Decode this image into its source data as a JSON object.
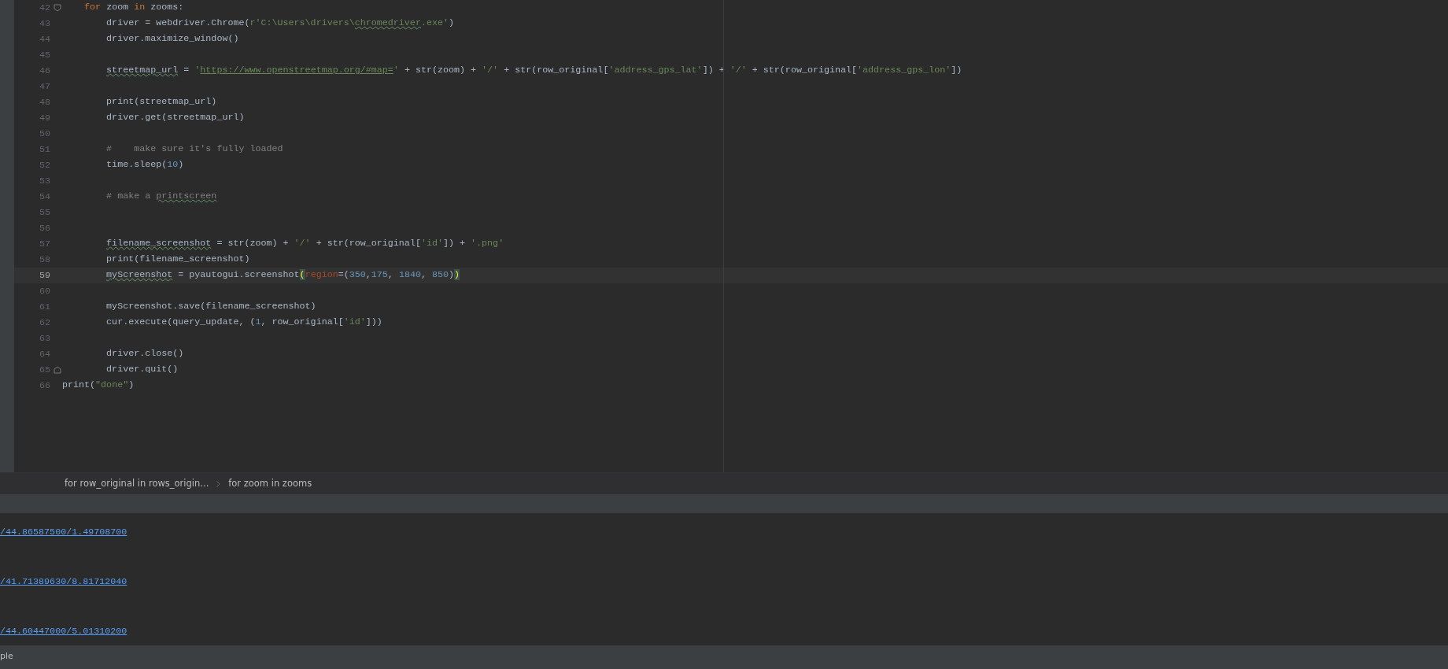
{
  "editor": {
    "lines": [
      {
        "number": "42",
        "current": false,
        "fold_start": true,
        "tokens": [
          {
            "text": "    for",
            "kind": "keyword"
          },
          {
            "text": " zoom ",
            "kind": "plain"
          },
          {
            "text": "in",
            "kind": "keyword"
          },
          {
            "text": " zooms:",
            "kind": "plain"
          }
        ]
      },
      {
        "number": "43",
        "current": false,
        "tokens": [
          {
            "text": "        driver = webdriver.Chrome(",
            "kind": "plain"
          },
          {
            "text": "r'C:\\Users\\drivers\\",
            "kind": "string"
          },
          {
            "text": "chromedriver",
            "kind": "string",
            "typo": true
          },
          {
            "text": ".exe'",
            "kind": "string"
          },
          {
            "text": ")",
            "kind": "plain"
          }
        ]
      },
      {
        "number": "44",
        "current": false,
        "tokens": [
          {
            "text": "        driver.maximize_window()",
            "kind": "plain"
          }
        ]
      },
      {
        "number": "45",
        "current": false
      },
      {
        "number": "46",
        "current": false,
        "tokens": [
          {
            "text": "        streetmap_url",
            "kind": "plain",
            "typo": true
          },
          {
            "text": " = ",
            "kind": "plain"
          },
          {
            "text": "'",
            "kind": "string"
          },
          {
            "text": "https://www.openstreetmap.org/#map=",
            "kind": "link"
          },
          {
            "text": "'",
            "kind": "string"
          },
          {
            "text": " + str(zoom) + ",
            "kind": "plain"
          },
          {
            "text": "'/'",
            "kind": "string"
          },
          {
            "text": " + str(row_original[",
            "kind": "plain"
          },
          {
            "text": "'address_gps_lat'",
            "kind": "string"
          },
          {
            "text": "]) + ",
            "kind": "plain"
          },
          {
            "text": "'/'",
            "kind": "string"
          },
          {
            "text": " + str(row_original[",
            "kind": "plain"
          },
          {
            "text": "'address_gps_lon'",
            "kind": "string"
          },
          {
            "text": "])",
            "kind": "plain"
          }
        ]
      },
      {
        "number": "47",
        "current": false
      },
      {
        "number": "48",
        "current": false,
        "tokens": [
          {
            "text": "        print(streetmap_url)",
            "kind": "plain"
          }
        ]
      },
      {
        "number": "49",
        "current": false,
        "tokens": [
          {
            "text": "        driver.get(streetmap_url)",
            "kind": "plain"
          }
        ]
      },
      {
        "number": "50",
        "current": false
      },
      {
        "number": "51",
        "current": false,
        "tokens": [
          {
            "text": "        #    make sure it's fully loaded",
            "kind": "comment"
          }
        ]
      },
      {
        "number": "52",
        "current": false,
        "tokens": [
          {
            "text": "        time.sleep(",
            "kind": "plain"
          },
          {
            "text": "10",
            "kind": "number"
          },
          {
            "text": ")",
            "kind": "plain"
          }
        ]
      },
      {
        "number": "53",
        "current": false
      },
      {
        "number": "54",
        "current": false,
        "tokens": [
          {
            "text": "        # make a ",
            "kind": "comment"
          },
          {
            "text": "printscreen",
            "kind": "comment",
            "typo": true
          }
        ]
      },
      {
        "number": "55",
        "current": false
      },
      {
        "number": "56",
        "current": false
      },
      {
        "number": "57",
        "current": false,
        "tokens": [
          {
            "text": "        filename_screenshot",
            "kind": "plain",
            "typo": true
          },
          {
            "text": " = str(zoom) + ",
            "kind": "plain"
          },
          {
            "text": "'/'",
            "kind": "string"
          },
          {
            "text": " + str(row_original[",
            "kind": "plain"
          },
          {
            "text": "'id'",
            "kind": "string"
          },
          {
            "text": "]) + ",
            "kind": "plain"
          },
          {
            "text": "'.png'",
            "kind": "string"
          }
        ]
      },
      {
        "number": "58",
        "current": false,
        "tokens": [
          {
            "text": "        print(filename_screenshot)",
            "kind": "plain"
          }
        ]
      },
      {
        "number": "59",
        "current": true,
        "tokens": [
          {
            "text": "        myScreenshot",
            "kind": "plain",
            "typo": true
          },
          {
            "text": " = pyautogui.screenshot",
            "kind": "plain"
          },
          {
            "text": "(",
            "kind": "match"
          },
          {
            "text": "region",
            "kind": "param"
          },
          {
            "text": "=(",
            "kind": "plain"
          },
          {
            "text": "350",
            "kind": "number"
          },
          {
            "text": ",",
            "kind": "plain"
          },
          {
            "text": "175",
            "kind": "number"
          },
          {
            "text": ", ",
            "kind": "plain"
          },
          {
            "text": "1840",
            "kind": "number"
          },
          {
            "text": ", ",
            "kind": "plain"
          },
          {
            "text": "850",
            "kind": "number"
          },
          {
            "text": ")",
            "kind": "plain"
          },
          {
            "text": ")",
            "kind": "match"
          }
        ]
      },
      {
        "number": "60",
        "current": false
      },
      {
        "number": "61",
        "current": false,
        "tokens": [
          {
            "text": "        myScreenshot.save(filename_screenshot)",
            "kind": "plain"
          }
        ]
      },
      {
        "number": "62",
        "current": false,
        "tokens": [
          {
            "text": "        cur.execute(query_update, (",
            "kind": "plain"
          },
          {
            "text": "1",
            "kind": "number"
          },
          {
            "text": ", row_original[",
            "kind": "plain"
          },
          {
            "text": "'id'",
            "kind": "string"
          },
          {
            "text": "]))",
            "kind": "plain"
          }
        ]
      },
      {
        "number": "63",
        "current": false
      },
      {
        "number": "64",
        "current": false,
        "tokens": [
          {
            "text": "        driver.close()",
            "kind": "plain"
          }
        ]
      },
      {
        "number": "65",
        "current": false,
        "fold_end": true,
        "tokens": [
          {
            "text": "        driver.quit()",
            "kind": "plain"
          }
        ]
      },
      {
        "number": "66",
        "current": false,
        "tokens": [
          {
            "text": "print(",
            "kind": "plain"
          },
          {
            "text": "\"done\"",
            "kind": "string"
          },
          {
            "text": ")",
            "kind": "plain"
          }
        ]
      }
    ]
  },
  "breadcrumbs": [
    "for row_original in rows_origin...",
    "for zoom in zooms"
  ],
  "console": {
    "links": [
      "/44.86587500/1.49708700",
      "/41.71389630/8.81712040",
      "/44.60447000/5.01310200"
    ]
  },
  "status_bar": {
    "text": "ple"
  }
}
